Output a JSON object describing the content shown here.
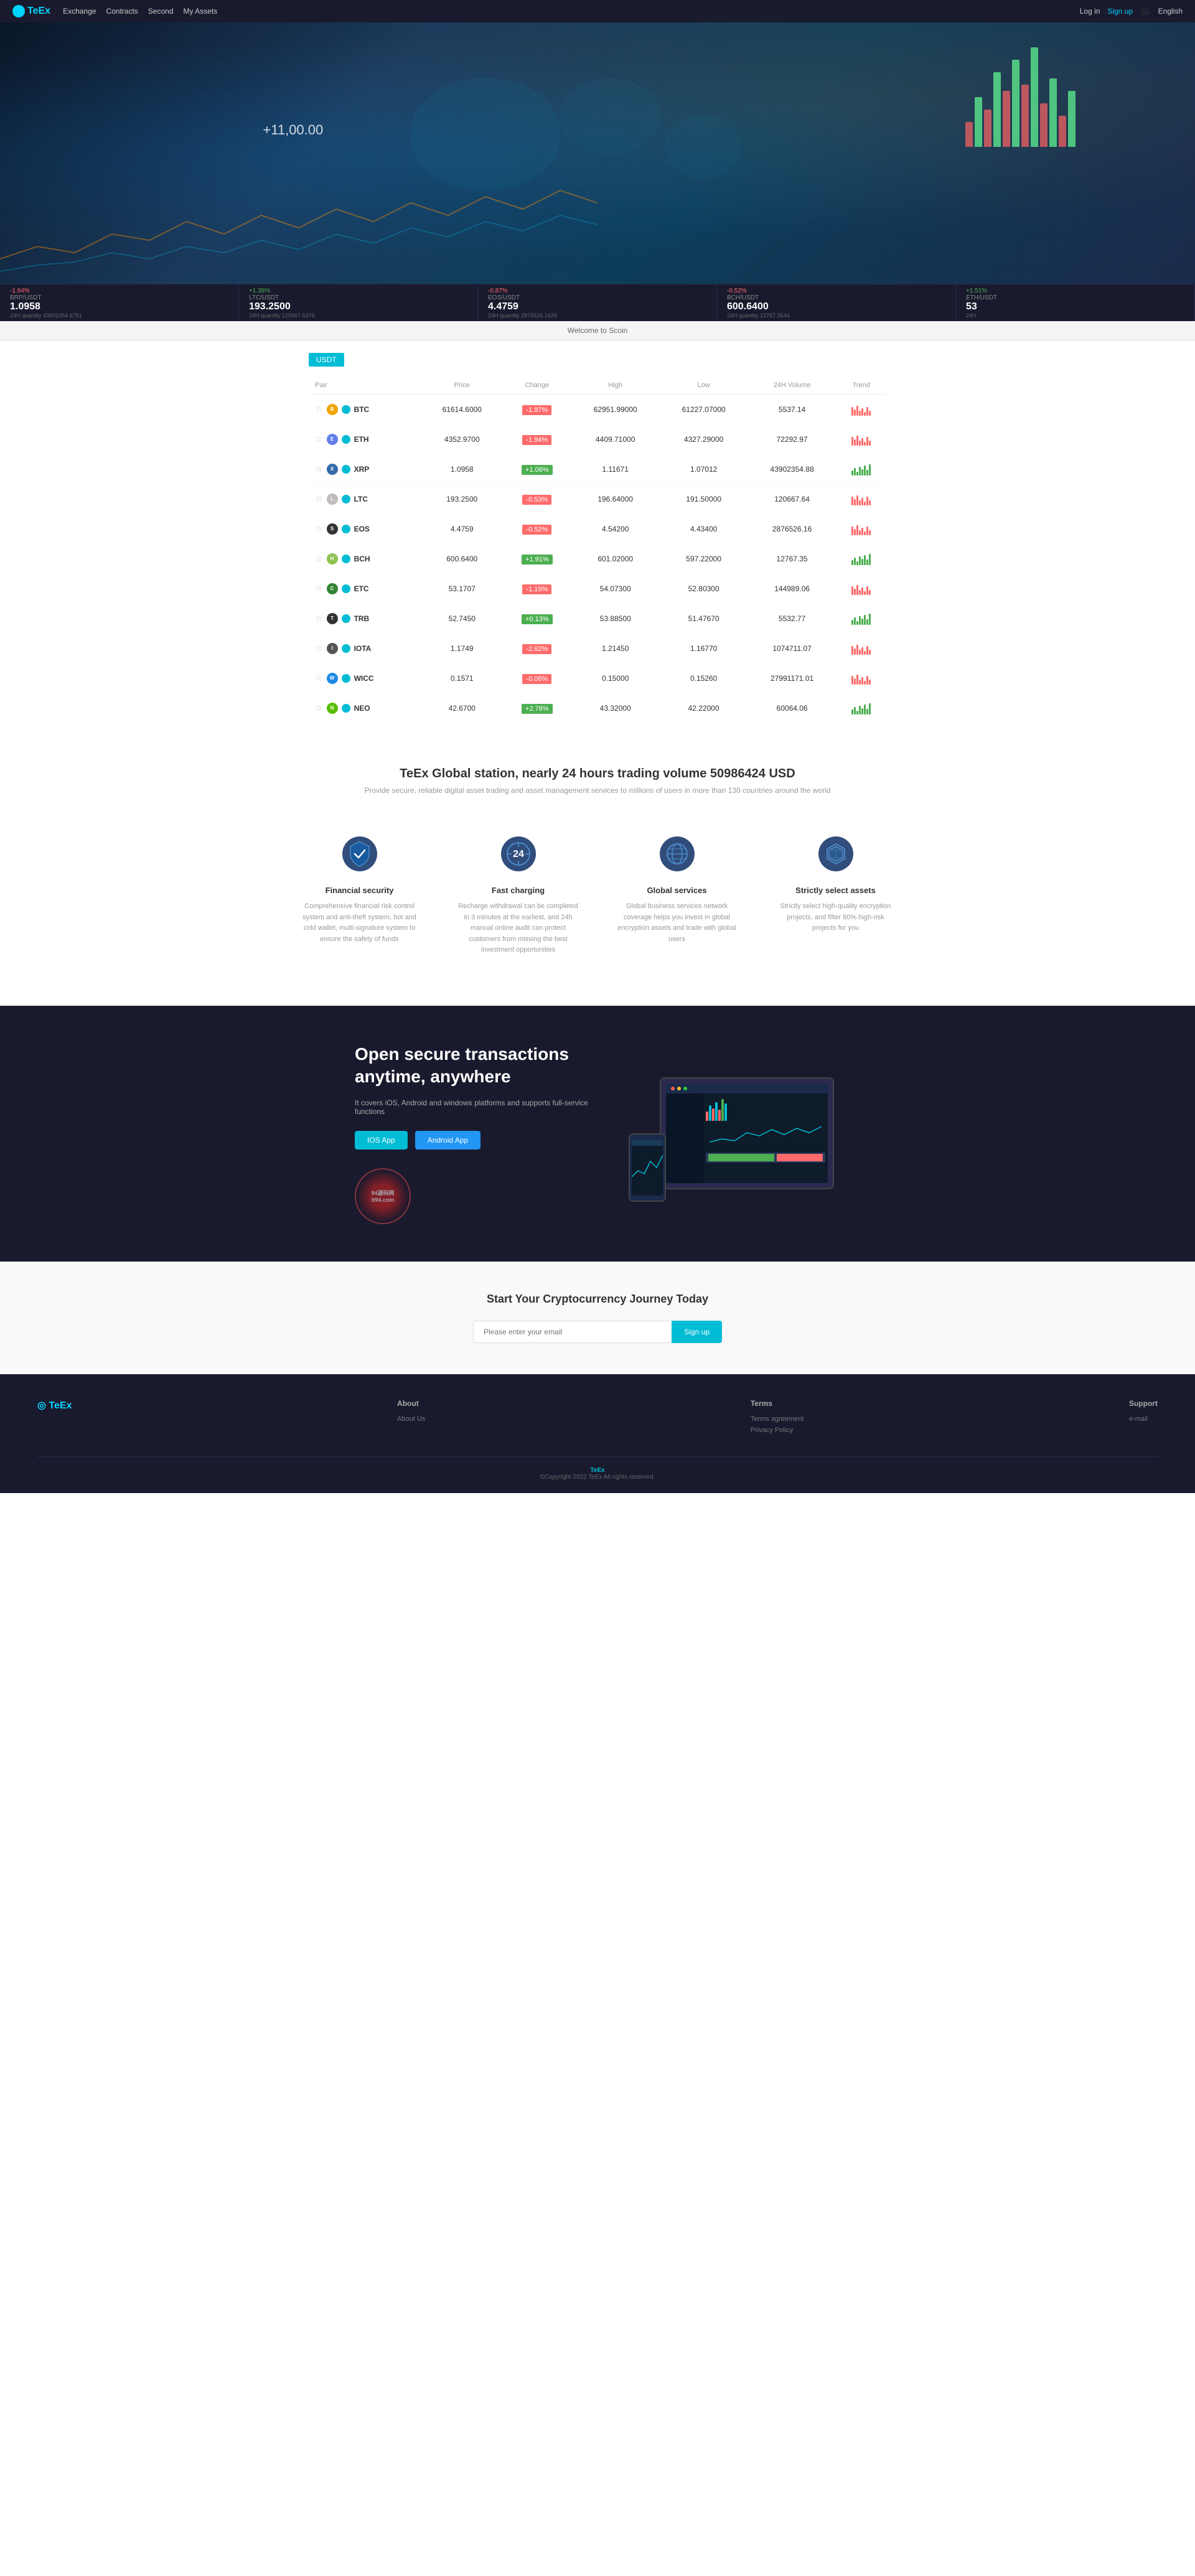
{
  "nav": {
    "logo": "TeEx",
    "links": [
      "Exchange",
      "Contracts",
      "Second",
      "My Assets"
    ],
    "login": "Log in",
    "signup": "Sign up",
    "language": "English"
  },
  "hero": {
    "price_tag": "+11,00.00"
  },
  "ticker": {
    "items": [
      {
        "pair": "BRP/USDT",
        "change": "-1.94%",
        "price": "1.0958",
        "volume": "24H quantity 43902354.6751",
        "trend": "down"
      },
      {
        "pair": "LTC/USDT",
        "change": "+1.38%",
        "price": "193.2500",
        "volume": "24H quantity 120667.6376",
        "trend": "up"
      },
      {
        "pair": "EOS/USDT",
        "change": "-0.87%",
        "price": "4.4759",
        "volume": "24H quantity 2876526.1629",
        "trend": "down"
      },
      {
        "pair": "BCH/USDT",
        "change": "-0.52%",
        "price": "600.6400",
        "volume": "24H quantity 12767.3544",
        "trend": "down"
      },
      {
        "pair": "ETH/USDT",
        "change": "+1.51%",
        "price": "53",
        "volume": "24H",
        "trend": "up"
      }
    ]
  },
  "welcome": {
    "text": "Welcome to Scoin"
  },
  "market": {
    "tab": "USDT",
    "headers": [
      "Pair",
      "Price",
      "Change",
      "High",
      "Low",
      "24H Volume",
      "Trend"
    ],
    "rows": [
      {
        "symbol": "BTC",
        "price": "61614.6000",
        "change": "-1.97%",
        "change_dir": "neg",
        "high": "62951.99000",
        "low": "61227.07000",
        "volume": "5537.14",
        "trend": "down"
      },
      {
        "symbol": "ETH",
        "price": "4352.9700",
        "change": "-1.94%",
        "change_dir": "neg",
        "high": "4409.71000",
        "low": "4327.29000",
        "volume": "72292.97",
        "trend": "down"
      },
      {
        "symbol": "XRP",
        "price": "1.0958",
        "change": "+1.06%",
        "change_dir": "pos",
        "high": "1.11671",
        "low": "1.07012",
        "volume": "43902354.88",
        "trend": "up"
      },
      {
        "symbol": "LTC",
        "price": "193.2500",
        "change": "-0.53%",
        "change_dir": "neg",
        "high": "196.64000",
        "low": "191.50000",
        "volume": "120667.64",
        "trend": "down"
      },
      {
        "symbol": "EOS",
        "price": "4.4759",
        "change": "-0.52%",
        "change_dir": "neg",
        "high": "4.54200",
        "low": "4.43400",
        "volume": "2876526.16",
        "trend": "down"
      },
      {
        "symbol": "BCH",
        "price": "600.6400",
        "change": "+1.91%",
        "change_dir": "pos",
        "high": "601.02000",
        "low": "597.22000",
        "volume": "12767.35",
        "trend": "up"
      },
      {
        "symbol": "ETC",
        "price": "53.1707",
        "change": "-1.19%",
        "change_dir": "neg",
        "high": "54.07300",
        "low": "52.80300",
        "volume": "144989.06",
        "trend": "down"
      },
      {
        "symbol": "TRB",
        "price": "52.7450",
        "change": "+0.13%",
        "change_dir": "pos",
        "high": "53.88500",
        "low": "51.47670",
        "volume": "5532.77",
        "trend": "up"
      },
      {
        "symbol": "IOTA",
        "price": "1.1749",
        "change": "-2.62%",
        "change_dir": "neg",
        "high": "1.21450",
        "low": "1.16770",
        "volume": "1074711.07",
        "trend": "down"
      },
      {
        "symbol": "WICC",
        "price": "0.1571",
        "change": "-0.06%",
        "change_dir": "neg",
        "high": "0.15000",
        "low": "0.15260",
        "volume": "27991171.01",
        "trend": "down"
      },
      {
        "symbol": "NEO",
        "price": "42.6700",
        "change": "+2.78%",
        "change_dir": "pos",
        "high": "43.32000",
        "low": "42.22000",
        "volume": "60064.06",
        "trend": "up"
      }
    ]
  },
  "stats": {
    "title_prefix": "TeEx Global station, nearly 24 hours trading volume",
    "volume": "50986424",
    "currency": "USD",
    "subtitle": "Provide secure, reliable digital asset trading and asset management services to millions of users in more than 130 countries around the world"
  },
  "features": [
    {
      "id": "financial",
      "title": "Financial security",
      "desc": "Comprehensive financial risk control system and anti-theft system, hot and cold wallet, multi-signature system to ensure the safety of funds",
      "icon": "shield"
    },
    {
      "id": "fast",
      "title": "Fast charging",
      "desc": "Recharge withdrawal can be completed in 3 minutes at the earliest, and 24h manual online audit can protect customers from missing the best investment opportunities",
      "icon": "clock24"
    },
    {
      "id": "global",
      "title": "Global services",
      "desc": "Global business services network coverage helps you invest in global encryption assets and trade with global users",
      "icon": "globe"
    },
    {
      "id": "strict",
      "title": "Strictly select assets",
      "desc": "Strictly select high-quality encryption projects, and filter 80% high-risk projects for you",
      "icon": "diamond"
    }
  ],
  "app_section": {
    "title": "Open secure transactions anytime, anywhere",
    "subtitle": "It covers iOS, Android and windows platforms and supports full-service functions",
    "ios_btn": "IOS App",
    "android_btn": "Android App"
  },
  "signup_section": {
    "title": "Start Your Cryptocurrency Journey Today",
    "placeholder": "Please enter your email",
    "btn_label": "Sign up"
  },
  "footer": {
    "logo": "TeEx",
    "cols": [
      {
        "heading": "About",
        "links": [
          "About Us"
        ]
      },
      {
        "heading": "Terms",
        "links": [
          "Terms agreement",
          "Privacy Policy"
        ]
      },
      {
        "heading": "Support",
        "links": [
          "e-mail"
        ]
      }
    ],
    "brand": "TeEx",
    "copyright": "©Copyright 2022 TeEx All rights reserved."
  }
}
